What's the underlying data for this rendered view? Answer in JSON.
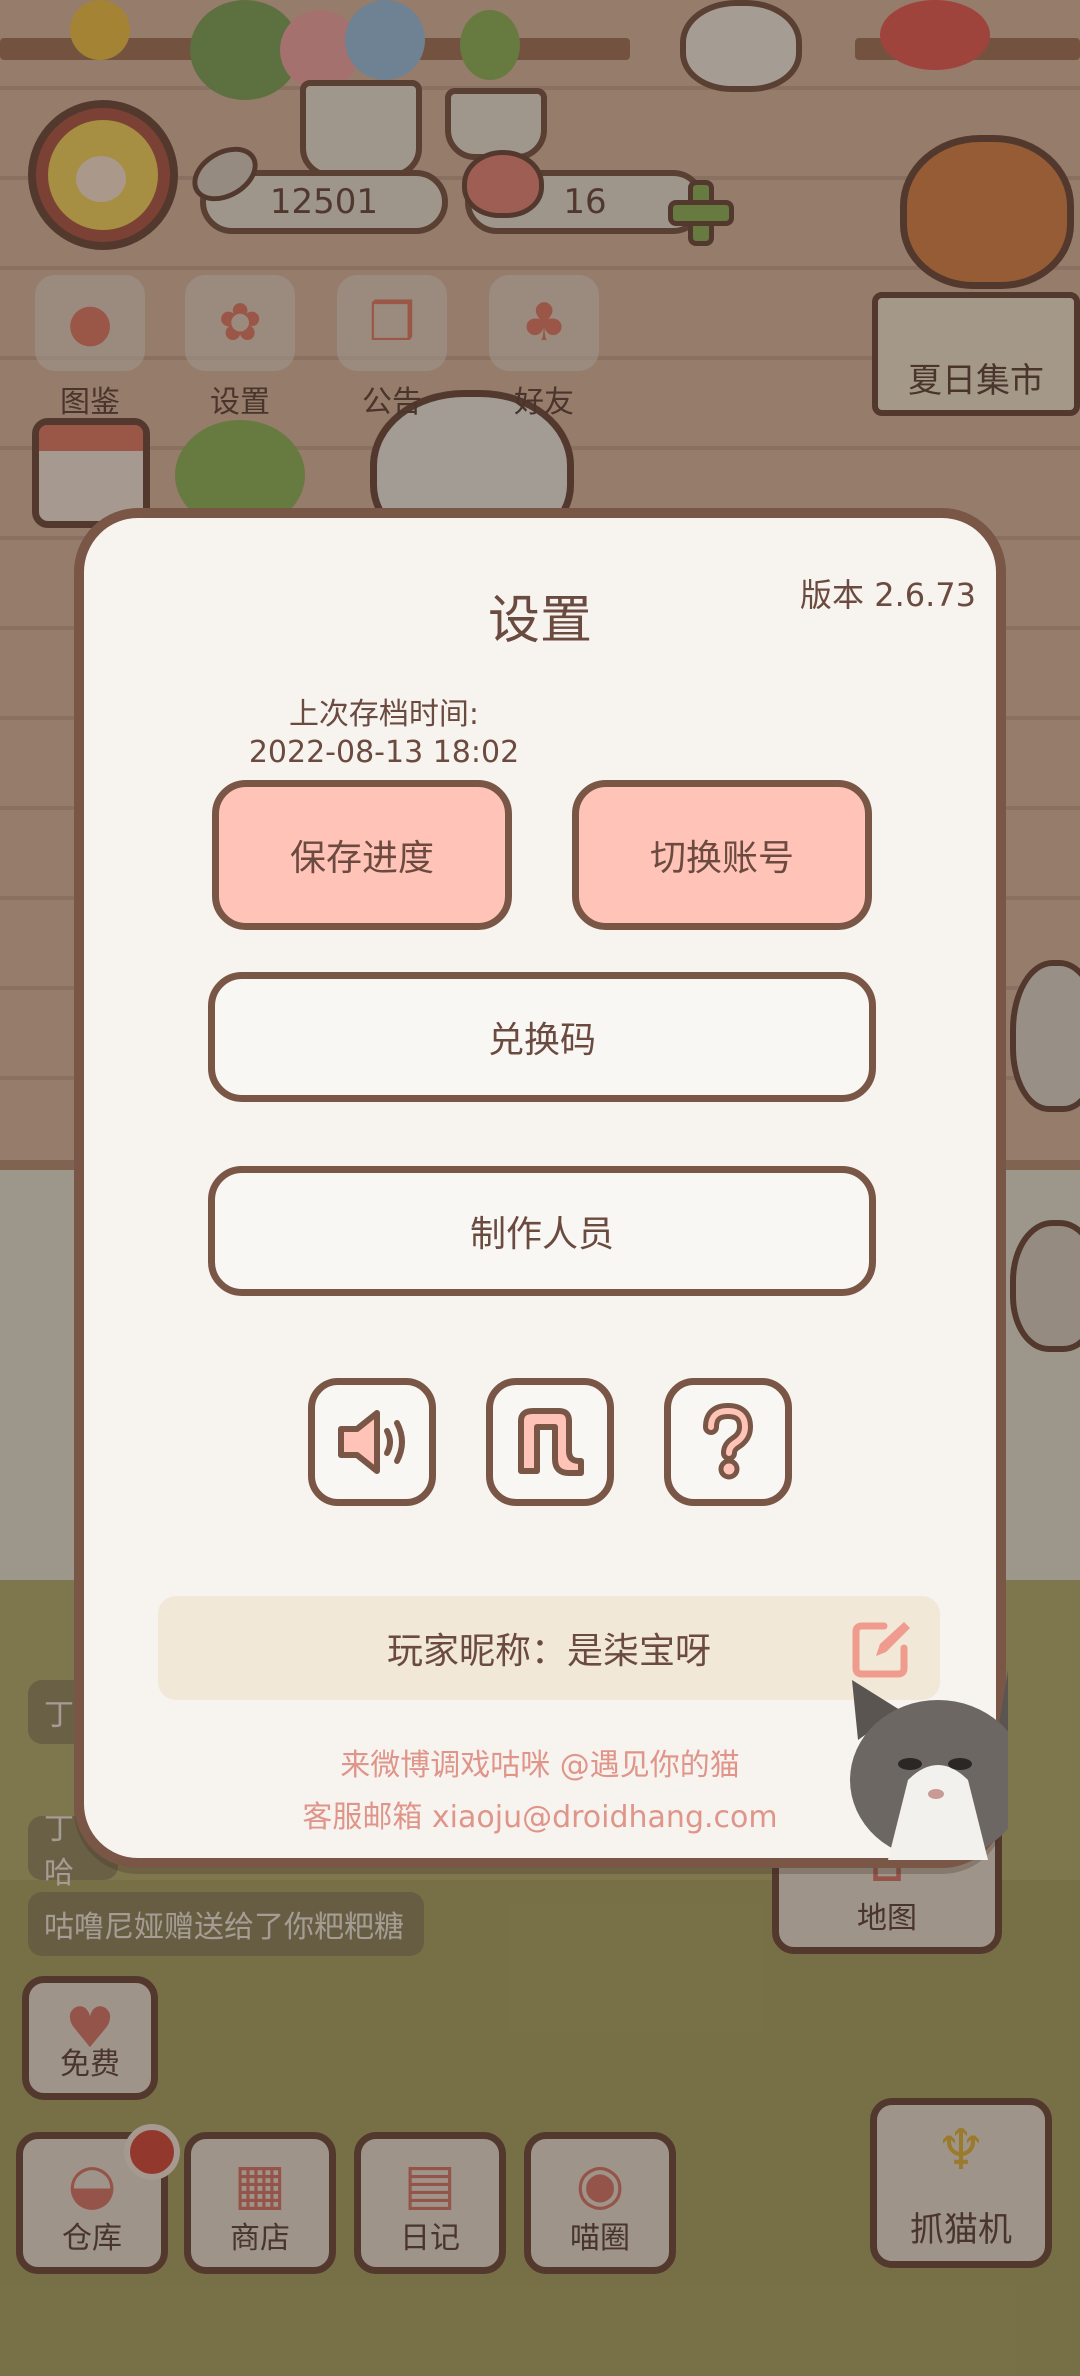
{
  "hud": {
    "fish_count": "12501",
    "heart_count": "16",
    "menu": [
      {
        "label": "图鉴",
        "glyph": "●"
      },
      {
        "label": "设置",
        "glyph": "✿"
      },
      {
        "label": "公告",
        "glyph": "❒"
      },
      {
        "label": "好友",
        "glyph": "♣"
      }
    ],
    "event_sign": "夏日集市"
  },
  "messages": [
    "丁",
    "丁哈",
    "咕噜尼娅赠送给了你粑粑糖"
  ],
  "bottom_bar": {
    "free": "免费",
    "warehouse": "仓库",
    "shop": "商店",
    "diary": "日记",
    "circle": "喵圈",
    "map": "地图",
    "claw_machine": "抓猫机"
  },
  "settings": {
    "title": "设置",
    "version": "版本 2.6.73",
    "last_save_label": "上次存档时间:",
    "last_save_time": "2022-08-13 18:02",
    "save_button": "保存进度",
    "switch_account_button": "切换账号",
    "redeem_code_button": "兑换码",
    "credits_button": "制作人员",
    "icons": [
      "sound-icon",
      "music-icon",
      "help-icon"
    ],
    "nickname": "玩家昵称：是柒宝呀",
    "weibo": "来微博调戏咕咪 @遇见你的猫",
    "email": "客服邮箱 xiaoju@droidhang.com"
  },
  "colors": {
    "accent_pink": "#ffc3b8",
    "border_brown": "#7a5646",
    "dialog_bg": "#f7f4ef",
    "footer_pink": "#e0958a"
  }
}
